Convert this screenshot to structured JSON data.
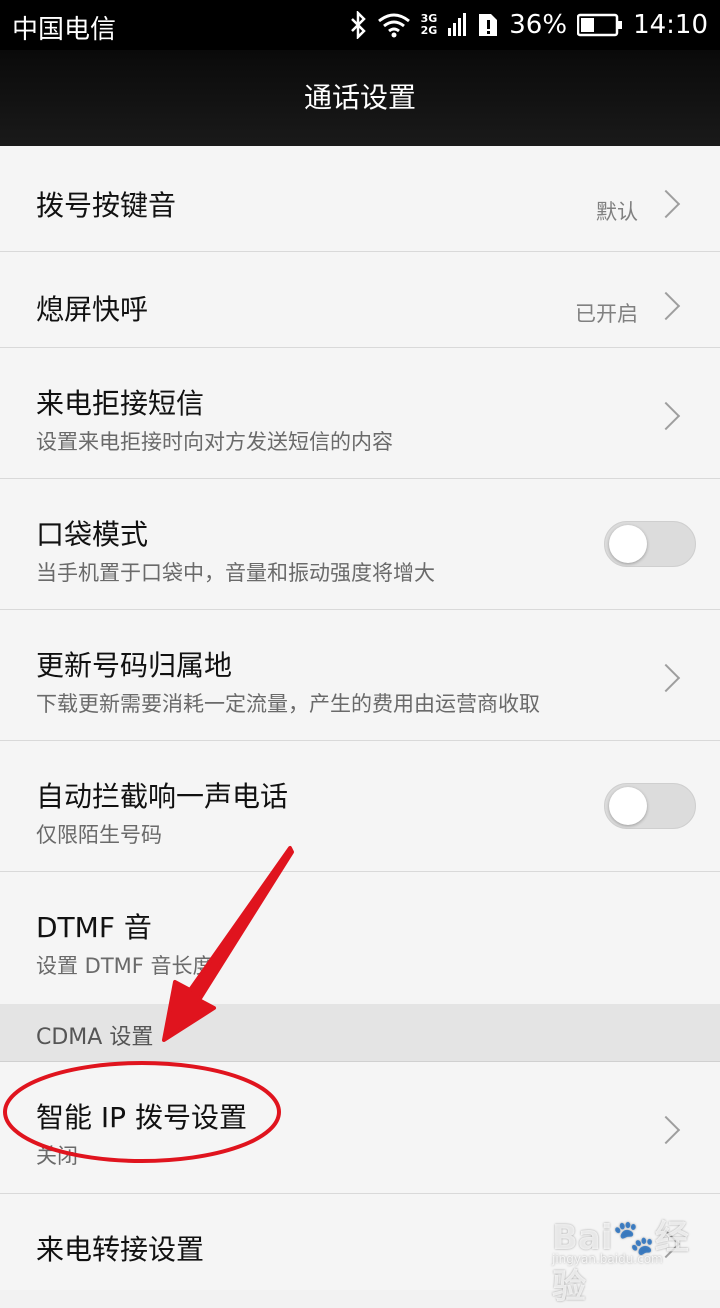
{
  "status_bar": {
    "carrier": "中国电信",
    "network_top": "3G",
    "network_bottom": "2G",
    "battery": "36%",
    "time": "14:10",
    "icons": [
      "bluetooth-icon",
      "wifi-icon",
      "signal-icon",
      "sim-alert-icon",
      "battery-icon"
    ]
  },
  "header": {
    "title": "通话设置"
  },
  "settings": {
    "dial_tone": {
      "title": "拨号按键音",
      "value": "默认"
    },
    "screen_off_call": {
      "title": "熄屏快呼",
      "value": "已开启"
    },
    "reject_sms": {
      "title": "来电拒接短信",
      "subtitle": "设置来电拒接时向对方发送短信的内容"
    },
    "pocket_mode": {
      "title": "口袋模式",
      "subtitle": "当手机置于口袋中，音量和振动强度将增大",
      "enabled": false
    },
    "update_location": {
      "title": "更新号码归属地",
      "subtitle": "下载更新需要消耗一定流量，产生的费用由运营商收取"
    },
    "block_one_ring": {
      "title": "自动拦截响一声电话",
      "subtitle": "仅限陌生号码",
      "enabled": false
    },
    "dtmf": {
      "title": "DTMF 音",
      "subtitle": "设置 DTMF 音长度"
    }
  },
  "cdma_section": {
    "header": "CDMA 设置",
    "smart_ip": {
      "title": "智能 IP 拨号设置",
      "subtitle": "关闭"
    },
    "call_forward": {
      "title": "来电转接设置"
    }
  },
  "annotation": {
    "color": "#e0141e"
  },
  "watermark": {
    "logo": "Bai🐾经验",
    "url": "jingyan.baidu.com"
  }
}
